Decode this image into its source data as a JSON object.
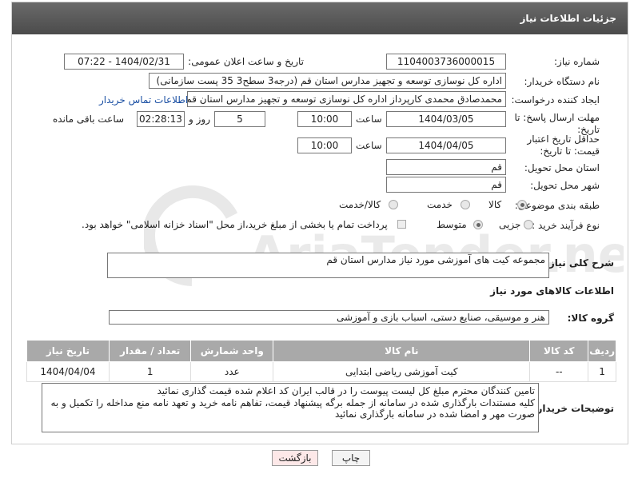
{
  "header": {
    "title": "جزئیات اطلاعات نیاز"
  },
  "labels": {
    "need_number": "شماره نیاز:",
    "announce_datetime": "تاریخ و ساعت اعلان عمومی:",
    "buyer_org": "نام دستگاه خریدار:",
    "requester": "ایجاد کننده درخواست:",
    "send_deadline": "مهلت ارسال پاسخ: تا تاریخ:",
    "price_validity": "حداقل تاریخ اعتبار قیمت: تا تاریخ:",
    "delivery_province": "استان محل تحویل:",
    "delivery_city": "شهر محل تحویل:",
    "category": "طبقه بندی موضوعی:",
    "process_type": "نوع فرآیند خرید :",
    "hour1": "ساعت",
    "hour2": "ساعت",
    "day_and": "روز و",
    "remaining": "ساعت باقی مانده",
    "description": "شرح کلی نیاز:",
    "goods_info": "اطلاعات کالاهای مورد نیاز",
    "goods_group": "گروه کالا:",
    "buyer_notes": "توضیحات خریدار:"
  },
  "fields": {
    "need_number": "1104003736000015",
    "announce_datetime": "1404/02/31 - 07:22",
    "buyer_org": "اداره کل نوسازی   توسعه و تجهیز مدارس استان قم (درجه3 سطح3  35 پست سازمانی)",
    "requester": "محمدصادق محمدی کارپرداز  اداره کل نوسازی   توسعه و تجهیز مدارس استان قم",
    "contact_link": "اطلاعات تماس خریدار",
    "send_date": "1404/03/05",
    "send_hour": "10:00",
    "days": "5",
    "remaining_time": "02:28:13",
    "validity_date": "1404/04/05",
    "validity_hour": "10:00",
    "province": "قم",
    "city": "قم",
    "description": "مجموعه کیت های آموزشی مورد نیاز مدارس استان قم",
    "goods_group": "هنر و موسیقی، صنایع دستی، اسباب بازی و آموزشی",
    "notes": "تامین کنندگان محترم مبلغ کل لیست پیوست را در قالب ایران کد اعلام شده قیمت گذاری نمائید\nکلیه مستندات بارگذاری شده در سامانه از جمله برگه پیشنهاد قیمت، تفاهم نامه خرید و تعهد نامه منع مداخله را تکمیل و به صورت مهر و امضا شده در سامانه بارگذاری نمائید"
  },
  "category_options": {
    "goods": "کالا",
    "service": "خدمت",
    "goods_service": "کالا/خدمت",
    "selected": "کالا"
  },
  "process_options": {
    "partial": "جزیی",
    "medium": "متوسط",
    "selected": "متوسط",
    "payment_note": "پرداخت تمام یا بخشی از مبلغ خرید،از محل \"اسناد خزانه اسلامی\" خواهد بود."
  },
  "table": {
    "headers": [
      "ردیف",
      "کد کالا",
      "نام کالا",
      "واحد شمارش",
      "تعداد / مقدار",
      "تاریخ نیاز"
    ],
    "rows": [
      [
        "1",
        "--",
        "کیت آموزشی ریاضی ابتدایی",
        "عدد",
        "1",
        "1404/04/04"
      ]
    ]
  },
  "buttons": {
    "print": "چاپ",
    "back": "بازگشت"
  },
  "watermark": {
    "text": "AriaTender.neT"
  },
  "colors": {
    "header_bg": "#555555",
    "table_header_bg": "#a9a9a9",
    "link": "#1a4fa3",
    "back_bg": "#fde8e8"
  }
}
